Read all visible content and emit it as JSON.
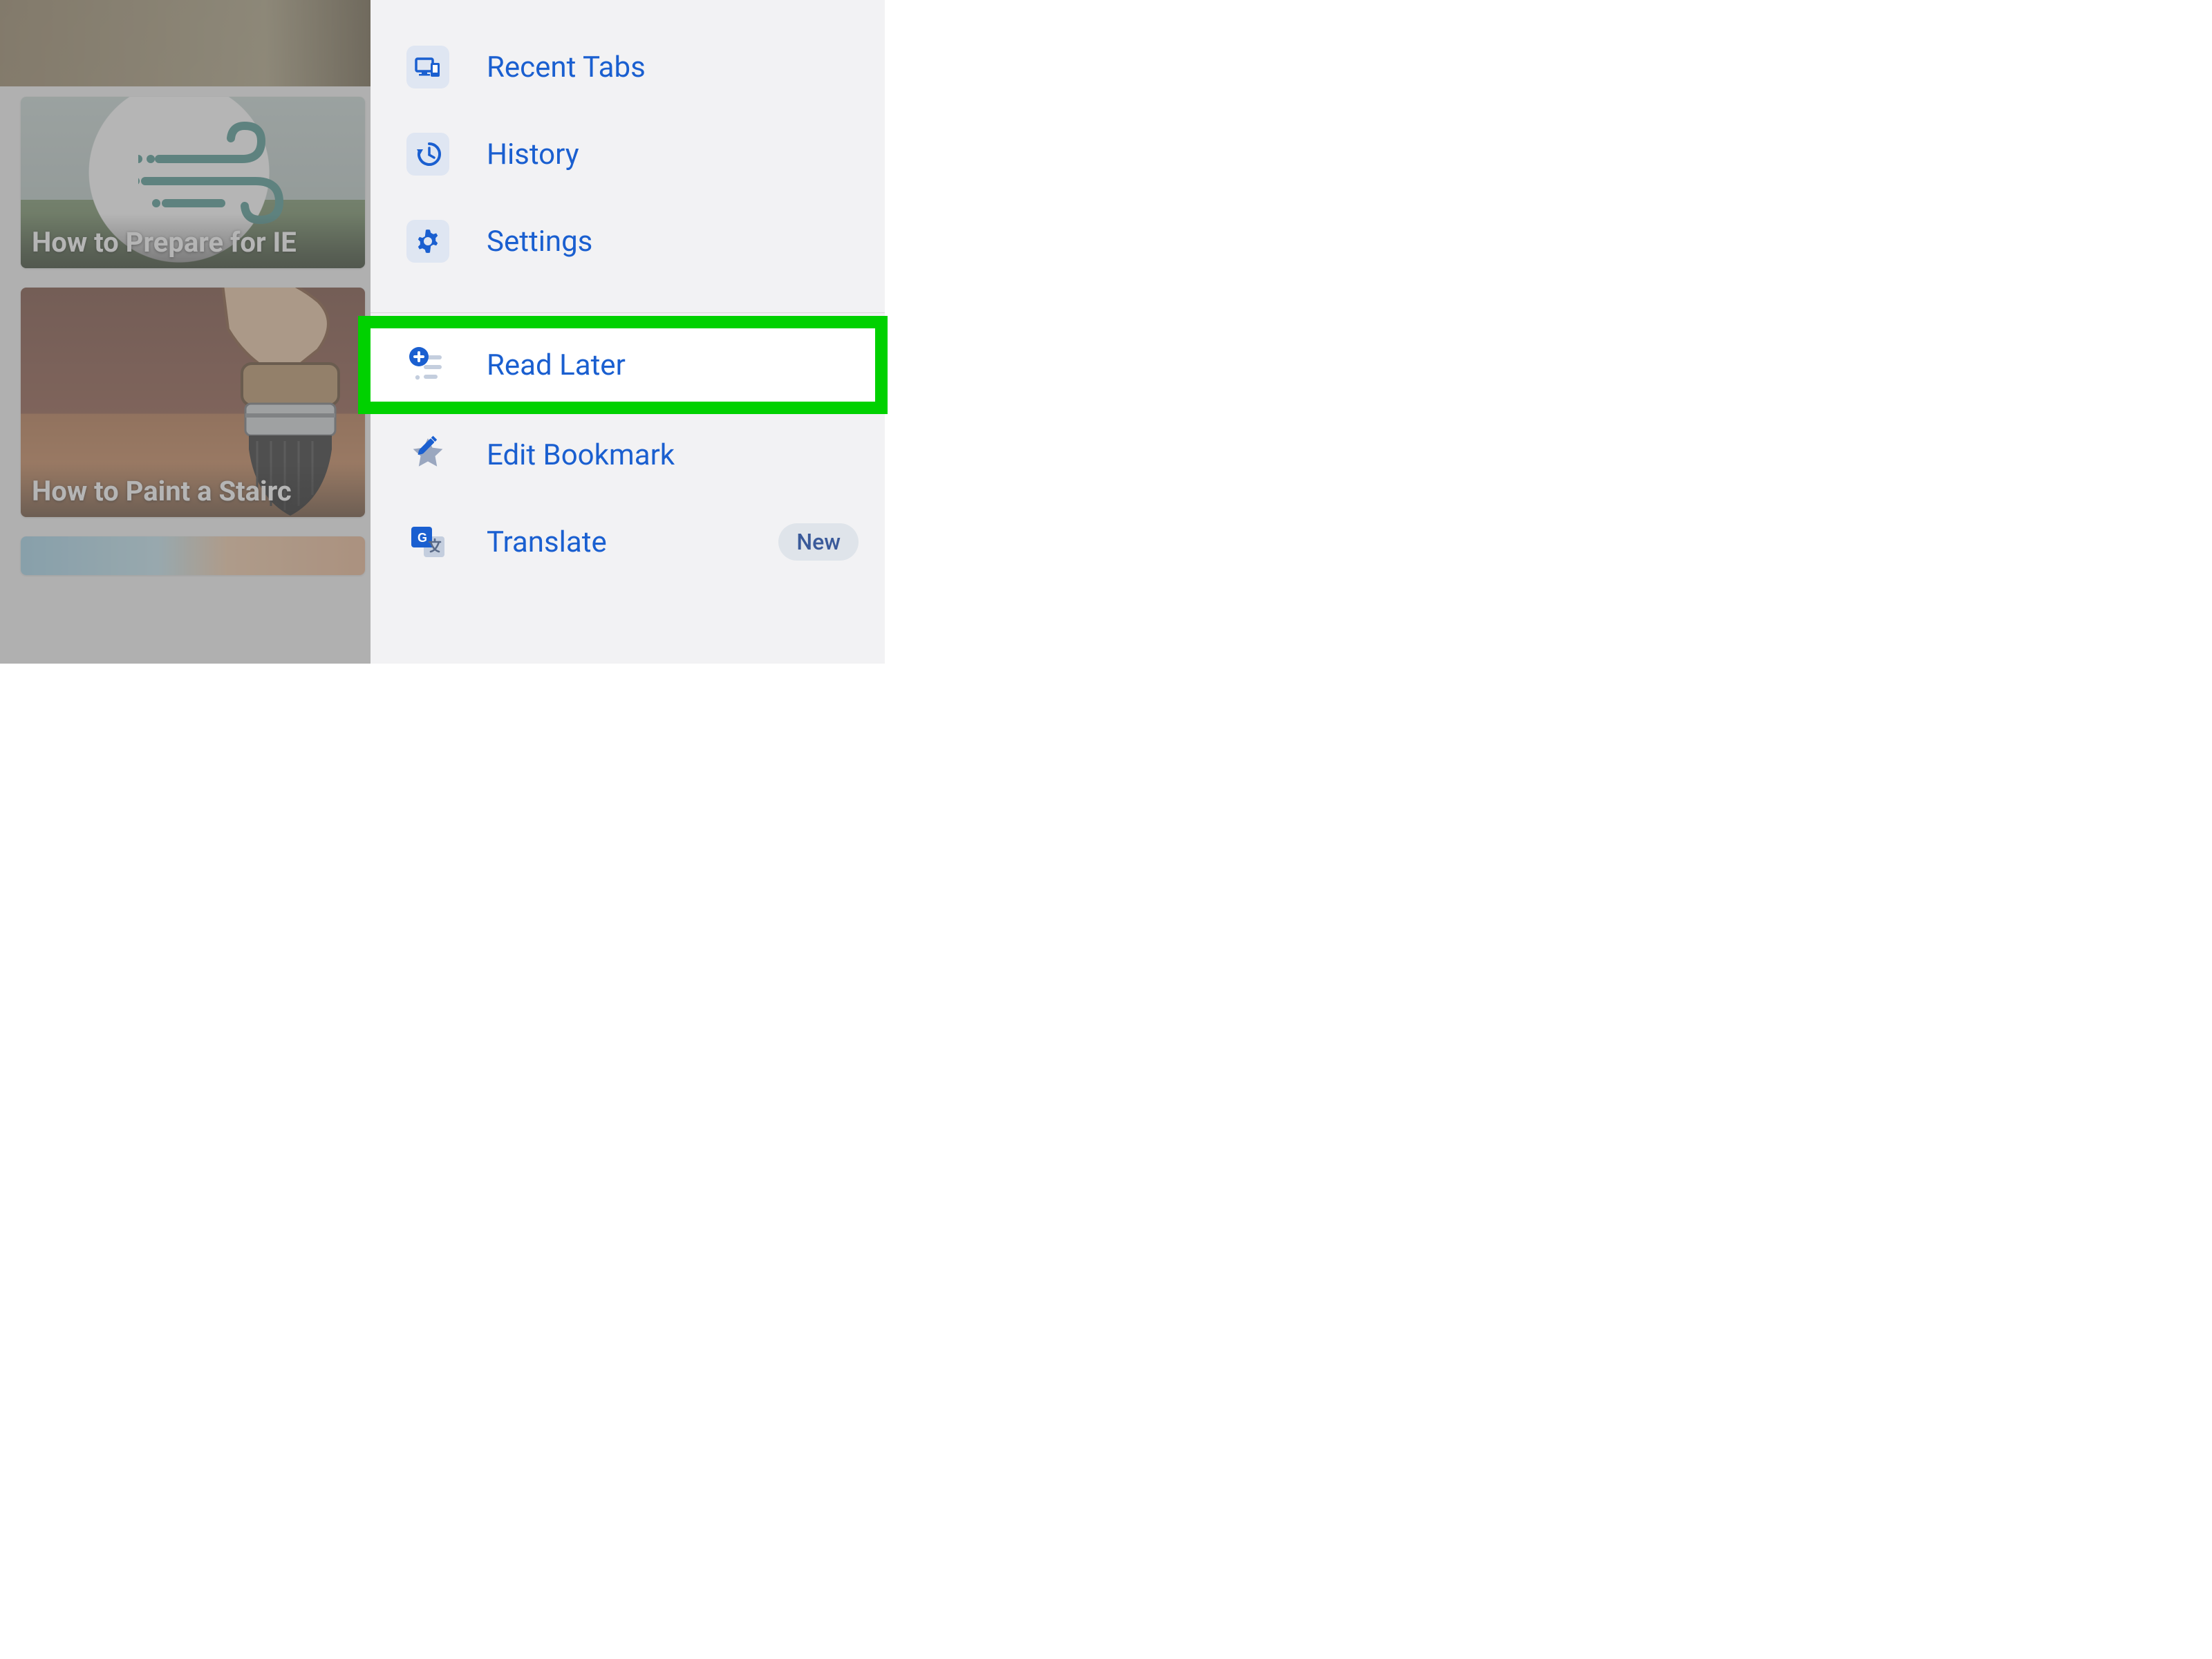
{
  "background": {
    "cards": [
      {
        "title": "How to Prepare for IE"
      },
      {
        "title": "How to Paint a Stairc"
      }
    ]
  },
  "menu": {
    "section1": [
      {
        "id": "recent-tabs",
        "label": "Recent Tabs"
      },
      {
        "id": "history",
        "label": "History"
      },
      {
        "id": "settings",
        "label": "Settings"
      }
    ],
    "section2": [
      {
        "id": "read-later",
        "label": "Read Later",
        "highlighted": true
      },
      {
        "id": "edit-bookmark",
        "label": "Edit Bookmark"
      },
      {
        "id": "translate",
        "label": "Translate",
        "badge": "New"
      }
    ]
  },
  "colors": {
    "menu_text": "#1a5fd0",
    "highlight_border": "#00d100",
    "badge_bg": "#dfe4ea"
  }
}
